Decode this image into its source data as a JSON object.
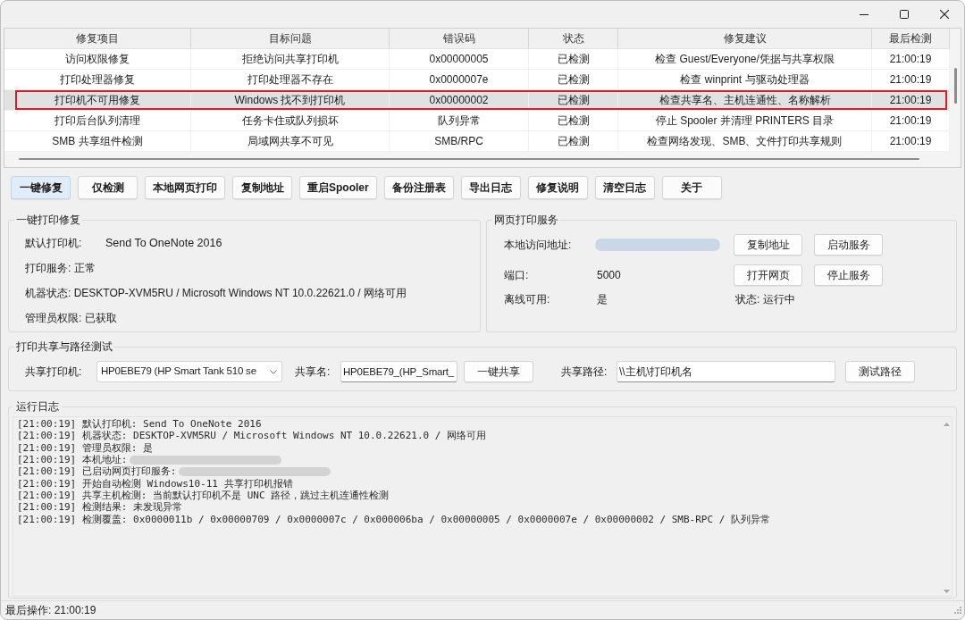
{
  "table": {
    "columns": [
      "修复项目",
      "目标问题",
      "错误码",
      "状态",
      "修复建议",
      "最后检测"
    ],
    "rows": [
      {
        "cells": [
          "访问权限修复",
          "拒绝访问共享打印机",
          "0x00000005",
          "已检测",
          "检查 Guest/Everyone/凭据与共享权限",
          "21:00:19"
        ],
        "selected": false,
        "highlighted": false
      },
      {
        "cells": [
          "打印处理器修复",
          "打印处理器不存在",
          "0x0000007e",
          "已检测",
          "检查 winprint 与驱动处理器",
          "21:00:19"
        ],
        "selected": false,
        "highlighted": false
      },
      {
        "cells": [
          "打印机不可用修复",
          "Windows 找不到打印机",
          "0x00000002",
          "已检测",
          "检查共享名、主机连通性、名称解析",
          "21:00:19"
        ],
        "selected": true,
        "highlighted": true
      },
      {
        "cells": [
          "打印后台队列清理",
          "任务卡住或队列损坏",
          "队列异常",
          "已检测",
          "停止 Spooler 并清理 PRINTERS 目录",
          "21:00:19"
        ],
        "selected": false,
        "highlighted": false
      },
      {
        "cells": [
          "SMB 共享组件检测",
          "局域网共享不可见",
          "SMB/RPC",
          "已检测",
          "检查网络发现、SMB、文件打印共享规则",
          "21:00:19"
        ],
        "selected": false,
        "highlighted": false
      }
    ]
  },
  "toolbar": [
    {
      "label": "一键修复",
      "focused": true
    },
    {
      "label": "仅检测",
      "focused": false
    },
    {
      "label": "本地网页打印",
      "focused": false
    },
    {
      "label": "复制地址",
      "focused": false
    },
    {
      "label": "重启Spooler",
      "focused": false
    },
    {
      "label": "备份注册表",
      "focused": false
    },
    {
      "label": "导出日志",
      "focused": false
    },
    {
      "label": "修复说明",
      "focused": false
    },
    {
      "label": "清空日志",
      "focused": false
    },
    {
      "label": "关于",
      "focused": false
    }
  ],
  "repair_panel": {
    "title": "一键打印修复",
    "items": [
      {
        "label": "默认打印机:",
        "value": "Send To OneNote 2016"
      },
      {
        "label": "打印服务: 正常"
      },
      {
        "label": "机器状态: DESKTOP-XVM5RU / Microsoft Windows NT 10.0.22621.0 / 网络可用"
      },
      {
        "label": "管理员权限: 已获取"
      }
    ]
  },
  "web_service": {
    "title": "网页打印服务",
    "rows": [
      {
        "label": "本地访问地址:",
        "blurred": true,
        "buttons": [
          "复制地址",
          "启动服务"
        ]
      },
      {
        "label": "端口:",
        "value": "5000",
        "blurred": false,
        "buttons": [
          "打开网页",
          "停止服务"
        ]
      },
      {
        "label": "离线可用:",
        "value": "是",
        "blurred": false,
        "status": "状态: 运行中"
      }
    ]
  },
  "share_test": {
    "title": "打印共享与路径测试",
    "printer_label": "共享打印机:",
    "printer_value": "HP0EBE79 (HP Smart Tank 510 se",
    "share_name_label": "共享名:",
    "share_name_value": "HP0EBE79_(HP_Smart_",
    "share_button": "一键共享",
    "path_label": "共享路径:",
    "path_value": "\\\\主机\\打印机名",
    "test_button": "测试路径"
  },
  "log": {
    "title": "运行日志",
    "lines": [
      {
        "text": "[21:00:19] 默认打印机: Send To OneNote 2016",
        "blurred": false
      },
      {
        "text": "[21:00:19] 机器状态: DESKTOP-XVM5RU / Microsoft Windows NT 10.0.22621.0 / 网络可用",
        "blurred": false
      },
      {
        "text": "[21:00:19] 管理员权限: 是",
        "blurred": false
      },
      {
        "text": "[21:00:19] 本机地址:",
        "blurred": true
      },
      {
        "text": "[21:00:19] 已启动网页打印服务:",
        "blurred": true
      },
      {
        "text": "[21:00:19] 开始自动检测 Windows10-11 共享打印机报错",
        "blurred": false
      },
      {
        "text": "[21:00:19] 共享主机检测: 当前默认打印机不是 UNC 路径，跳过主机连通性检测",
        "blurred": false
      },
      {
        "text": "[21:00:19] 检测结果: 未发现异常",
        "blurred": false
      },
      {
        "text": "[21:00:19] 检测覆盖: 0x0000011b / 0x00000709 / 0x0000007c / 0x000006ba / 0x00000005 / 0x0000007e / 0x00000002 / SMB-RPC / 队列异常",
        "blurred": false
      }
    ]
  },
  "status_bar": {
    "text": "最后操作: 21:00:19"
  }
}
